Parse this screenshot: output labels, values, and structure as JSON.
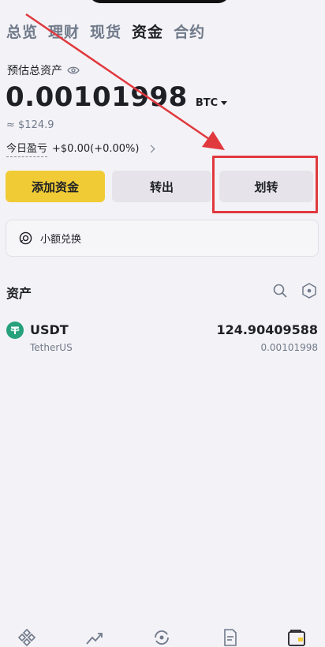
{
  "tabs": [
    {
      "label": "总览"
    },
    {
      "label": "理财"
    },
    {
      "label": "现货"
    },
    {
      "label": "资金"
    },
    {
      "label": "合约"
    }
  ],
  "summary": {
    "est_label": "预估总资产",
    "balance": "0.00101998",
    "unit": "BTC",
    "fiat": "≈ $124.9",
    "pnl_label": "今日盈亏",
    "pnl_value": "+$0.00(+0.00%)"
  },
  "actions": {
    "add": "添加资金",
    "withdraw": "转出",
    "transfer": "划转"
  },
  "convert": {
    "label": "小额兑换"
  },
  "assets": {
    "title": "资产",
    "items": [
      {
        "symbol": "USDT",
        "name": "TetherUS",
        "amount": "124.90409588",
        "btc_value": "0.00101998"
      }
    ]
  },
  "colors": {
    "accent": "#f0cb35",
    "annotation": "#e0393e",
    "usdt": "#26a17b"
  }
}
